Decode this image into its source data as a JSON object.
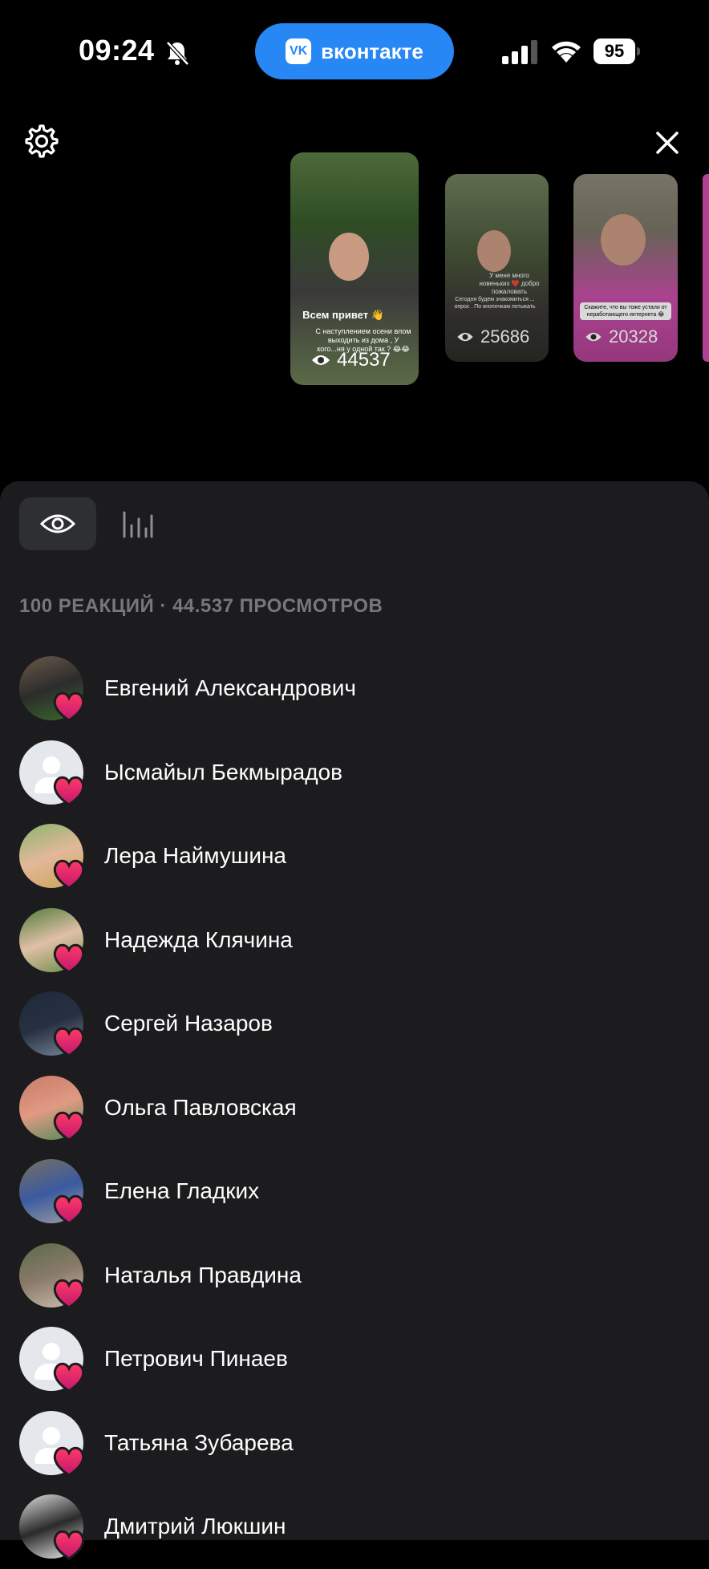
{
  "status_bar": {
    "time": "09:24",
    "app_pill_label": "вконтакте",
    "battery": "95"
  },
  "stories": [
    {
      "caption": "Всем привет 👋",
      "subcaption": "С наступлением осени влом выходить из дома , У кого...ня у одной так ? 😂😂",
      "views": "44537"
    },
    {
      "caption": "У меня много новеньких ❤️ добро пожаловать",
      "subcaption": "Сегодня будем знакомиться ... опрос . По кнопочкам потыкать",
      "views": "25686"
    },
    {
      "caption": "Скажите, что вы тоже устали от неработающего интернета 😂",
      "views": "20328"
    }
  ],
  "sheet": {
    "summary": "100 РЕАКЦИЙ · 44.537 ПРОСМОТРОВ",
    "viewers": [
      {
        "name": "Евгений Александрович",
        "avatar": "photo",
        "colors": [
          "#6a5a4a",
          "#2c2c2c",
          "#3b6b2b"
        ]
      },
      {
        "name": "Ысмайыл Бекмырадов",
        "avatar": "placeholder"
      },
      {
        "name": "Лера Наймушина",
        "avatar": "photo",
        "colors": [
          "#8bb46b",
          "#e3b89a",
          "#c9a35a"
        ]
      },
      {
        "name": "Надежда Клячина",
        "avatar": "photo",
        "colors": [
          "#4d7a35",
          "#e0c0a8",
          "#6a8a45"
        ]
      },
      {
        "name": "Сергей Назаров",
        "avatar": "photo",
        "colors": [
          "#1e2a3a",
          "#263040",
          "#7a8a9a"
        ]
      },
      {
        "name": "Ольга Павловская",
        "avatar": "photo",
        "colors": [
          "#c97a6a",
          "#e09a82",
          "#4a8a5a"
        ]
      },
      {
        "name": "Елена Гладких",
        "avatar": "photo",
        "colors": [
          "#7a7060",
          "#3a5aa0",
          "#a0a0a0"
        ]
      },
      {
        "name": "Наталья Правдина",
        "avatar": "photo",
        "colors": [
          "#5a6a4a",
          "#8a7a6a",
          "#d0c0b0"
        ]
      },
      {
        "name": "Петрович Пинаев",
        "avatar": "placeholder"
      },
      {
        "name": "Татьяна Зубарева",
        "avatar": "placeholder"
      },
      {
        "name": "Дмитрий Люкшин",
        "avatar": "photo",
        "colors": [
          "#e0e0e0",
          "#2a2a2a",
          "#f0f0f0"
        ]
      }
    ]
  },
  "colors": {
    "accent": "#2787f5",
    "sheet_bg": "#1c1c1e",
    "muted_text": "#76787a",
    "heart_top": "#ff3a66",
    "heart_bottom": "#c0186f"
  },
  "icons": {
    "settings": "gear-icon",
    "close": "close-icon",
    "views_tab": "eye-icon",
    "stats_tab": "bar-chart-icon",
    "reaction": "heart-icon"
  }
}
